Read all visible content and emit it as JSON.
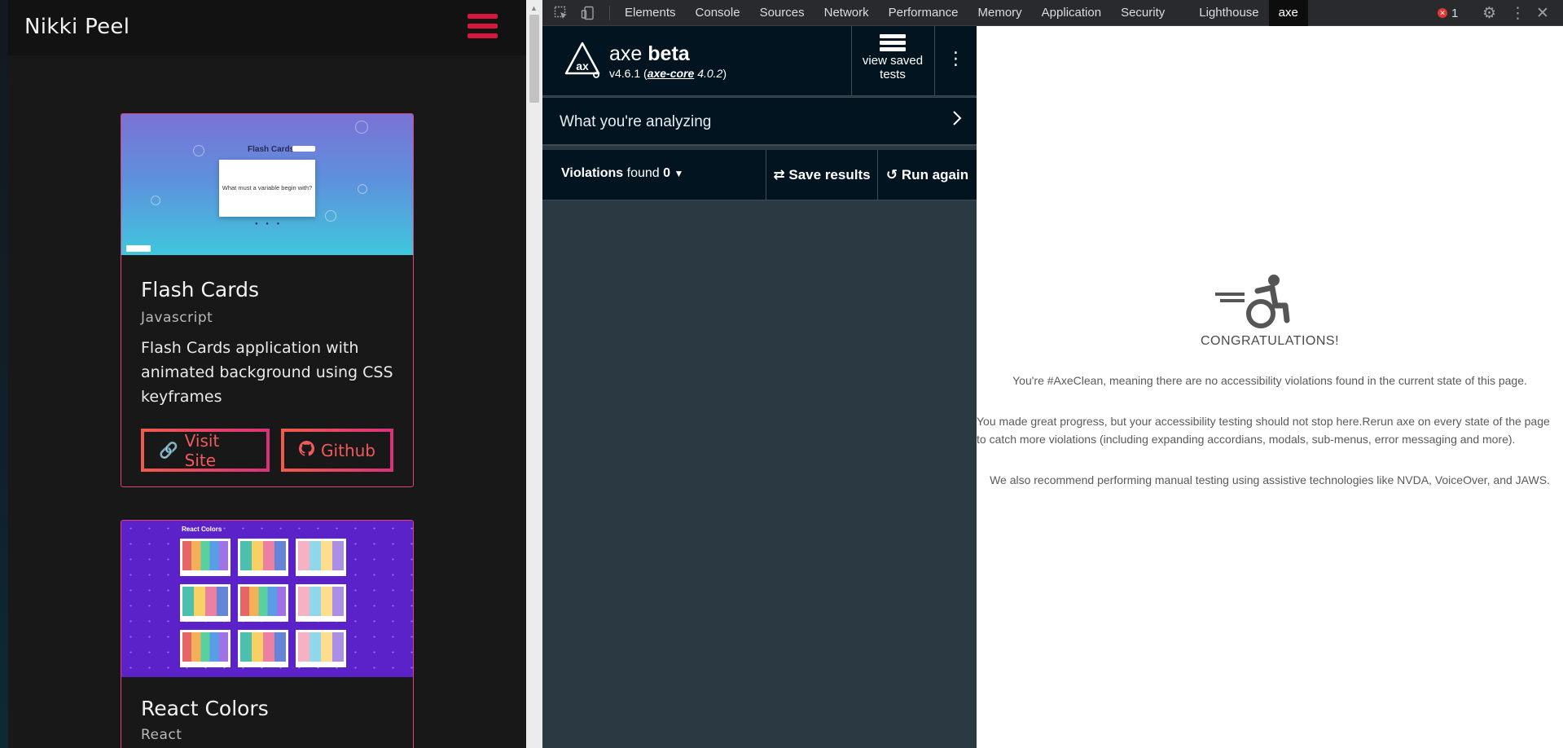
{
  "site": {
    "brand": "Nikki Peel",
    "projects": [
      {
        "title": "Flash Cards",
        "language": "Javascript",
        "description": "Flash Cards application with animated background using CSS keyframes",
        "visit_label": "Visit Site",
        "github_label": "Github",
        "thumb_title": "Flash Cards",
        "thumb_question": "What must a variable begin with?"
      },
      {
        "title": "React Colors",
        "language": "React",
        "thumb_title": "React Colors"
      }
    ]
  },
  "devtools": {
    "tabs": [
      "Elements",
      "Console",
      "Sources",
      "Network",
      "Performance",
      "Memory",
      "Application",
      "Security",
      "Lighthouse",
      "axe"
    ],
    "active_tab": "axe",
    "error_count": "1"
  },
  "axe": {
    "name": "axe",
    "name_suffix": "beta",
    "version": "v4.6.1",
    "core_link": "axe-core",
    "core_version": "4.0.2",
    "saved_tests_label_1": "view saved",
    "saved_tests_label_2": "tests",
    "analyzing_label": "What you're analyzing",
    "violations_label": "Violations",
    "found_label": "found",
    "violations_count": "0",
    "save_results_label": "Save results",
    "run_again_label": "Run again"
  },
  "results": {
    "heading": "CONGRATULATIONS!",
    "p1": "You're #AxeClean, meaning there are no accessibility violations found in the current state of this page.",
    "p2": "You made great progress, but your accessibility testing should not stop here.Rerun axe on every state of the page to catch more violations (including expanding accordians, modals, sub-menus, error messaging and more).",
    "p3": "We also recommend performing manual testing using assistive technologies like NVDA, VoiceOver, and JAWS."
  },
  "colors": {
    "accent": "#d8173e",
    "button_gradient_start": "#ef5a4b",
    "button_gradient_end": "#d9327a",
    "axe_header": "#021420",
    "axe_panel": "#2b3a42"
  }
}
